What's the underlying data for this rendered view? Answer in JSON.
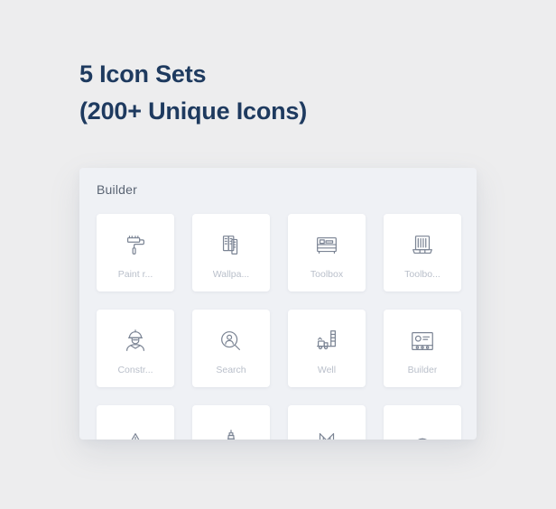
{
  "headline": {
    "line1": "5 Icon Sets",
    "line2": "(200+ Unique Icons)",
    "color": "#1e3a5f"
  },
  "panel": {
    "title": "Builder",
    "background": "#eff1f5",
    "card_background": "#ffffff",
    "label_color": "#b9bfca",
    "icon_color": "#7b8494"
  },
  "icons": [
    {
      "label": "Paint r...",
      "icon": "paint-roller-icon"
    },
    {
      "label": "Wallpa...",
      "icon": "wallpaper-icon"
    },
    {
      "label": "Toolbox",
      "icon": "toolbox-shelf-icon"
    },
    {
      "label": "Toolbo...",
      "icon": "toolbox-open-icon"
    },
    {
      "label": "Constr...",
      "icon": "construction-worker-icon"
    },
    {
      "label": "Search",
      "icon": "search-person-icon"
    },
    {
      "label": "Well",
      "icon": "oil-well-icon"
    },
    {
      "label": "Builder",
      "icon": "blueprint-board-icon"
    },
    {
      "label": "",
      "icon": "tent-structure-icon"
    },
    {
      "label": "",
      "icon": "lighthouse-icon"
    },
    {
      "label": "",
      "icon": "bridge-icon"
    },
    {
      "label": "",
      "icon": "dome-icon"
    }
  ]
}
